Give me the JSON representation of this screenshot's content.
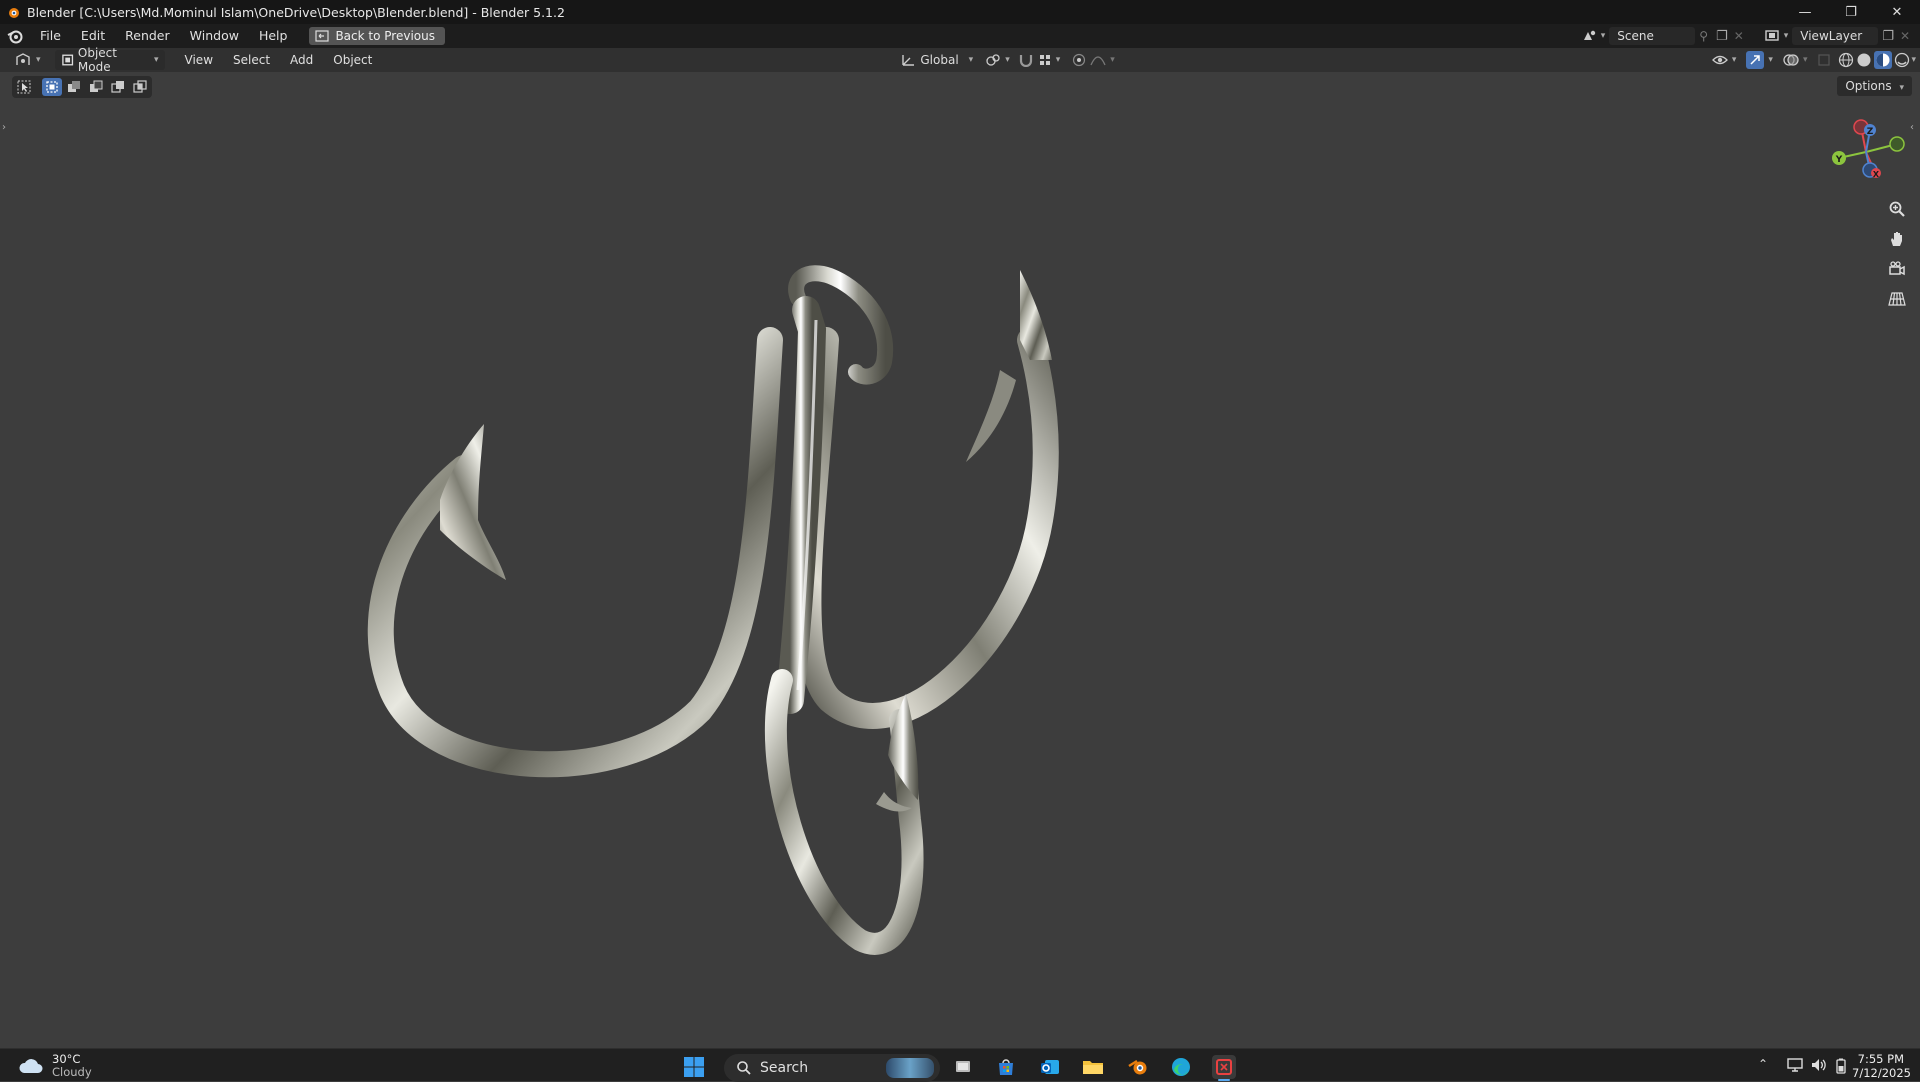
{
  "window": {
    "title": "Blender [C:\\Users\\Md.Mominul Islam\\OneDrive\\Desktop\\Blender.blend] - Blender 5.1.2"
  },
  "menubar": {
    "items": [
      "File",
      "Edit",
      "Render",
      "Window",
      "Help"
    ],
    "back_button": "Back to Previous",
    "scene": "Scene",
    "view_layer": "ViewLayer"
  },
  "header": {
    "mode": "Object Mode",
    "menus": [
      "View",
      "Select",
      "Add",
      "Object"
    ],
    "transform_orientation": "Global"
  },
  "viewport": {
    "options_label": "Options",
    "gizmo_axes": [
      "X",
      "Y",
      "Z"
    ]
  },
  "taskbar": {
    "weather_temp": "30°C",
    "weather_desc": "Cloudy",
    "search_label": "Search",
    "time": "7:55 PM",
    "date": "7/12/2025"
  },
  "colors": {
    "accent": "#4772b3",
    "viewport_bg": "#3d3d3d",
    "x_axis": "#e0474e",
    "y_axis": "#8cc43e",
    "z_axis": "#4f83d1"
  }
}
